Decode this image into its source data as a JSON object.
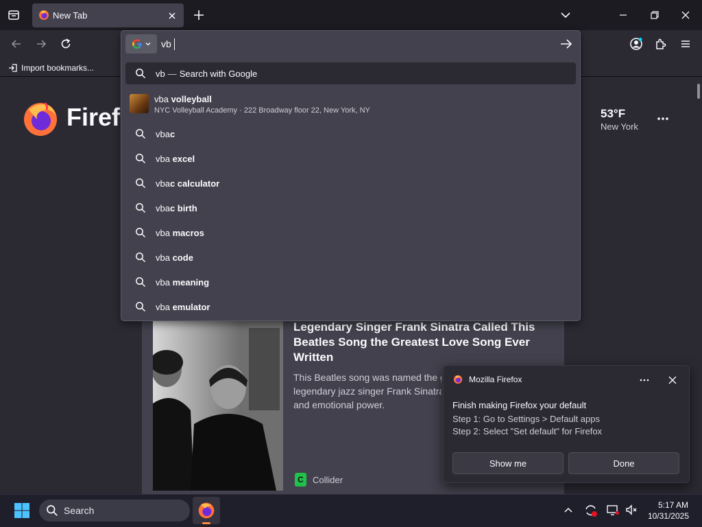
{
  "tabs": [
    {
      "title": "New Tab"
    }
  ],
  "toolbar": {
    "import_bookmarks": "Import bookmarks..."
  },
  "urlbar": {
    "input_value": "vb",
    "search_engine_icon": "google-g-icon",
    "suggestions": [
      {
        "prefix": "vb",
        "bold": "",
        "action": "Search with Google",
        "selected": true
      },
      {
        "prefix": "vba ",
        "bold": "volleyball",
        "subtitle": "NYC Volleyball Academy · 222 Broadway floor 22, New York, NY",
        "type": "place"
      },
      {
        "prefix": "vba",
        "bold": "c"
      },
      {
        "prefix": "vba ",
        "bold": "excel"
      },
      {
        "prefix": "vba",
        "bold": "c calculator"
      },
      {
        "prefix": "vba",
        "bold": "c birth"
      },
      {
        "prefix": "vba ",
        "bold": "macros"
      },
      {
        "prefix": "vba ",
        "bold": "code"
      },
      {
        "prefix": "vba ",
        "bold": "meaning"
      },
      {
        "prefix": "vba ",
        "bold": "emulator"
      }
    ]
  },
  "newtab": {
    "wordmark": "Firefox",
    "weather": {
      "temp": "53°F",
      "city": "New York"
    },
    "story": {
      "title": "Legendary Singer Frank Sinatra Called This Beatles Song the Greatest Love Song Ever Written",
      "description": "This Beatles song was named the greatest love song ever by legendary jazz singer Frank Sinatra for its timeless magic and emotional power.",
      "source": "Collider",
      "source_letter": "C"
    }
  },
  "notification": {
    "app": "Mozilla Firefox",
    "title": "Finish making Firefox your default",
    "step1": "Step 1: Go to Settings > Default apps",
    "step2": "Step 2: Select \"Set default\" for Firefox",
    "show_me": "Show me",
    "done": "Done"
  },
  "taskbar": {
    "search_label": "Search",
    "time": "5:17 AM",
    "date": "10/31/2025"
  },
  "colors": {
    "accent": "#00ddff",
    "firefox_orange": "#ff7139",
    "popup_bg": "#42414d",
    "toolbar_bg": "#2b2a33"
  }
}
